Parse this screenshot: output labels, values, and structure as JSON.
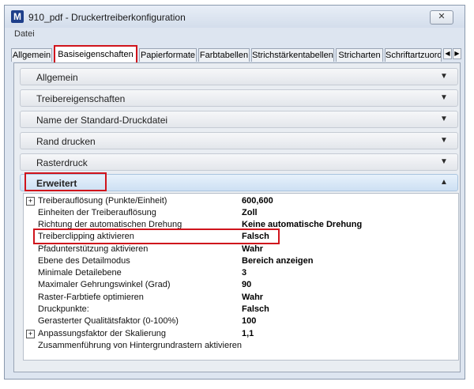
{
  "window": {
    "title": "910_pdf - Druckertreiberkonfiguration",
    "app_icon": "M",
    "close_glyph": "✕"
  },
  "menu": {
    "items": [
      "Datei"
    ]
  },
  "tabs": [
    {
      "label": "Allgemein"
    },
    {
      "label": "Basiseigenschaften",
      "active": true
    },
    {
      "label": "Papierformate"
    },
    {
      "label": "Farbtabellen"
    },
    {
      "label": "Strichstärkentabellen"
    },
    {
      "label": "Stricharten"
    },
    {
      "label": "Schriftartzuord"
    }
  ],
  "sections": [
    {
      "label": "Allgemein",
      "expanded": false
    },
    {
      "label": "Treibereigenschaften",
      "expanded": false
    },
    {
      "label": "Name der Standard-Druckdatei",
      "expanded": false
    },
    {
      "label": "Rand drucken",
      "expanded": false
    },
    {
      "label": "Rasterdruck",
      "expanded": false
    },
    {
      "label": "Erweitert",
      "expanded": true
    }
  ],
  "icons": {
    "chevron_down": "chevron-down-icon",
    "chevron_up": "chevron-up-icon",
    "expand_plus": "plus-box-icon"
  },
  "properties": [
    {
      "name": "Treiberauflösung (Punkte/Einheit)",
      "value": "600,600",
      "expandable": true
    },
    {
      "name": "Einheiten der Treiberauflösung",
      "value": "Zoll"
    },
    {
      "name": "Richtung der automatischen Drehung",
      "value": "Keine automatische Drehung"
    },
    {
      "name": "Treiberclipping aktivieren",
      "value": "Falsch",
      "highlighted": true
    },
    {
      "name": "Pfadunterstützung aktivieren",
      "value": "Wahr"
    },
    {
      "name": "Ebene des Detailmodus",
      "value": "Bereich anzeigen"
    },
    {
      "name": "Minimale Detailebene",
      "value": "3"
    },
    {
      "name": "Maximaler Gehrungswinkel (Grad)",
      "value": "90"
    },
    {
      "name": "Raster-Farbtiefe optimieren",
      "value": "Wahr"
    },
    {
      "name": "Druckpunkte:",
      "value": "Falsch"
    },
    {
      "name": "Gerasterter Qualitätsfaktor (0-100%)",
      "value": "100"
    },
    {
      "name": "Anpassungsfaktor der Skalierung",
      "value": "1,1",
      "expandable": true
    },
    {
      "name": "Zusammenführung von Hintergrundrastern aktivieren",
      "value": ""
    }
  ],
  "colors": {
    "highlight": "#d0141c",
    "expanded_header": "#cde0f3",
    "window_bg": "#dde5f0"
  }
}
